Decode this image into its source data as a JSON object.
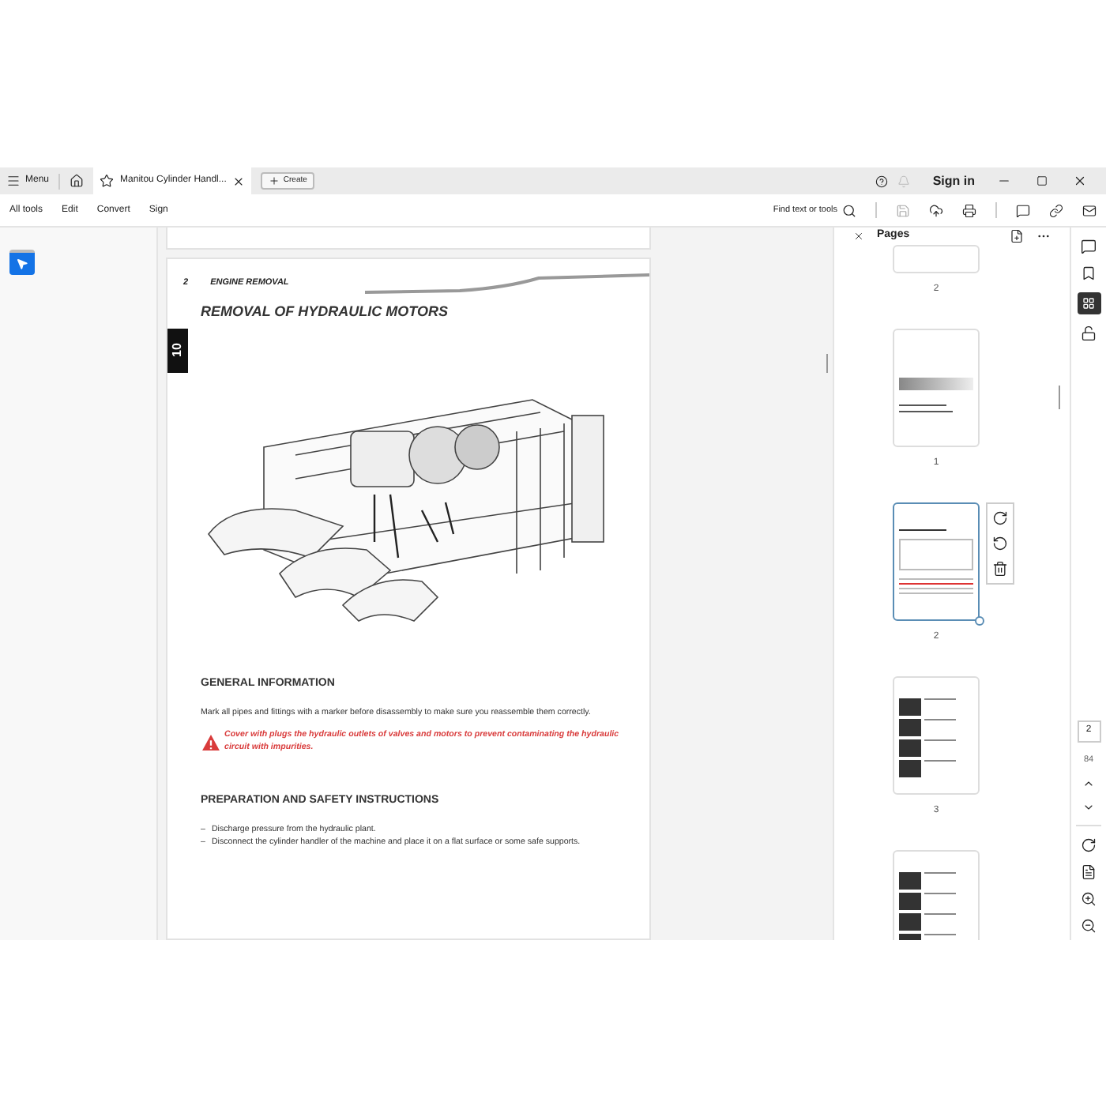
{
  "tabbar": {
    "menu": "Menu",
    "tab": {
      "title": "Manitou Cylinder Handl...",
      "selected": true
    },
    "create": "Create",
    "sign_in": "Sign in"
  },
  "toolbar": {
    "items": [
      "All tools",
      "Edit",
      "Convert",
      "Sign"
    ],
    "search": "Find text or tools"
  },
  "document": {
    "header_number": "2",
    "header_title": "ENGINE REMOVAL",
    "chapter_tab": "10",
    "title": "REMOVAL OF HYDRAULIC MOTORS",
    "blocks": [
      {
        "kind": "heading",
        "text": "GENERAL INFORMATION"
      },
      {
        "kind": "paragraph",
        "text": "Mark all pipes and fittings with a marker before disassembly to make sure you reassemble them correctly."
      },
      {
        "kind": "warning",
        "text": "Cover with plugs the hydraulic outlets of valves and motors to prevent contaminating the hydraulic circuit with impurities."
      },
      {
        "kind": "heading",
        "text": "PREPARATION AND SAFETY INSTRUCTIONS"
      },
      {
        "kind": "bullet",
        "marker": "–",
        "text": "Discharge pressure from the hydraulic plant."
      },
      {
        "kind": "bullet",
        "marker": "–",
        "text": "Disconnect the cylinder handler of the machine and place it on a flat surface or some safe supports."
      }
    ]
  },
  "pages_panel": {
    "title": "Pages",
    "thumbnails": [
      {
        "kind": "blank",
        "label": "2",
        "selected": false
      },
      {
        "kind": "cover",
        "label": "1",
        "selected": false
      },
      {
        "kind": "diagram",
        "label": "2",
        "selected": true
      },
      {
        "kind": "photos",
        "label": "3",
        "selected": false
      },
      {
        "kind": "photos",
        "selected": false
      }
    ]
  },
  "page_nav": {
    "current": "2",
    "total": "84"
  }
}
